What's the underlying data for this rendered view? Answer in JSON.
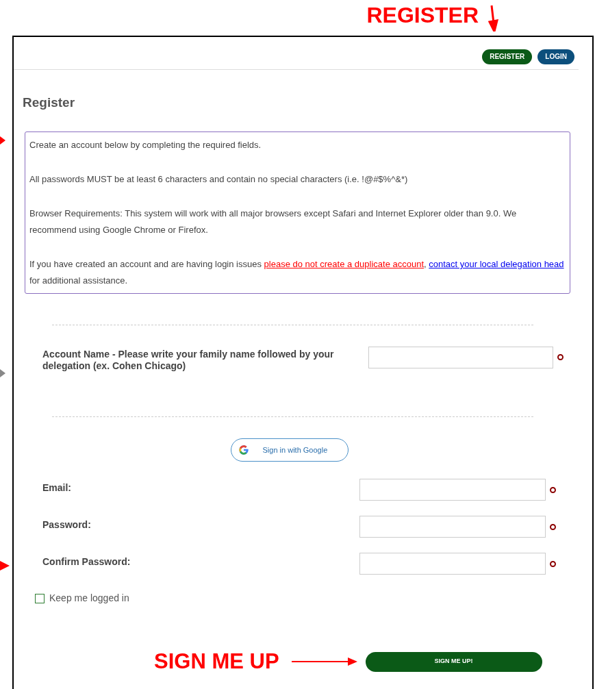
{
  "annotations": {
    "top": {
      "text": "REGISTER"
    },
    "bottom": {
      "text": "SIGN ME UP"
    }
  },
  "header": {
    "buttons": [
      {
        "label": "REGISTER",
        "color": "#0b5a17"
      },
      {
        "label": "LOGIN",
        "color": "#0c4f7c"
      }
    ]
  },
  "title": "Register",
  "info": {
    "paragraphs": [
      [
        {
          "kind": "text",
          "text": "Create an account below by completing the required fields."
        }
      ],
      [
        {
          "kind": "text",
          "text": "All passwords MUST be at least 6 characters and contain no special characters (i.e. !@#$%^&*)"
        }
      ],
      [
        {
          "kind": "text",
          "text": "Browser Requirements: This system will work with all major browsers except Safari and Internet Explorer older than 9.0. We recommend using  Google Chrome or Firefox."
        }
      ],
      [
        {
          "kind": "text",
          "text": "If you have created an account and are having login issues "
        },
        {
          "kind": "warning_link",
          "text": "please do not create a duplicate account"
        },
        {
          "kind": "text",
          "text": ", "
        },
        {
          "kind": "link",
          "text": "contact your local delegation head"
        },
        {
          "kind": "text",
          "text": " for additional assistance."
        }
      ]
    ]
  },
  "account_field": {
    "label": "Account Name - Please write your family name followed by your delegation (ex. Cohen Chicago)",
    "required": true
  },
  "google_button": {
    "label": "Sign in with Google"
  },
  "fields": [
    {
      "label": "Email:",
      "required": true
    },
    {
      "label": "Password:",
      "required": true
    },
    {
      "label": "Confirm Password:",
      "required": true
    }
  ],
  "remember": {
    "label": "Keep me logged in",
    "checked": false
  },
  "submit": {
    "label": "SIGN ME UP!"
  }
}
